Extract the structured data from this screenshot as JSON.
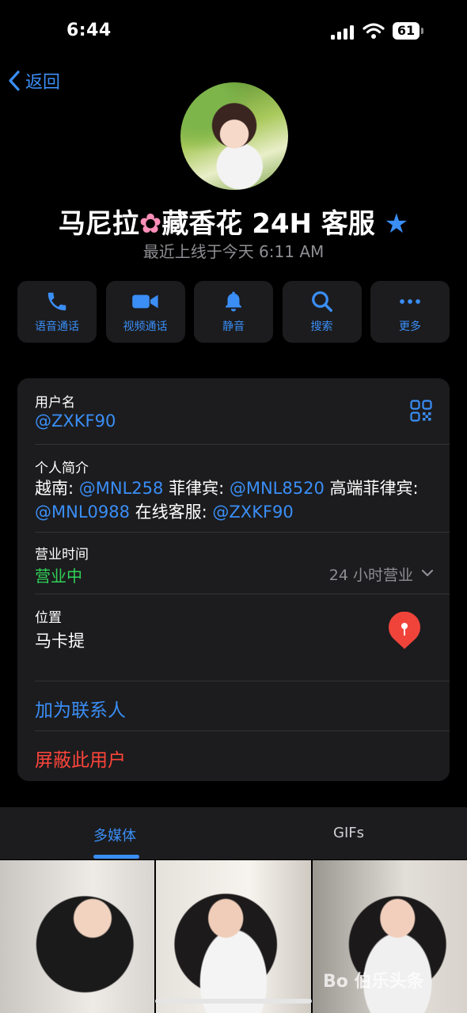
{
  "status_bar": {
    "time": "6:44",
    "battery": "61"
  },
  "nav": {
    "back_label": "返回"
  },
  "profile": {
    "name_a": "马尼拉",
    "name_b": "藏香花 24H 客服",
    "last_seen": "最近上线于今天 6:11 AM"
  },
  "actions": [
    {
      "label": "语音通话",
      "icon": "phone-icon"
    },
    {
      "label": "视频通话",
      "icon": "video-icon"
    },
    {
      "label": "静音",
      "icon": "bell-icon"
    },
    {
      "label": "搜索",
      "icon": "search-icon"
    },
    {
      "label": "更多",
      "icon": "more-icon"
    }
  ],
  "info": {
    "username_label": "用户名",
    "username_value": "@ZXKF90",
    "bio_label": "个人简介",
    "bio": {
      "p1": "越南: ",
      "m1": "@MNL258",
      "p2": " 菲律宾: ",
      "m2": "@MNL8520",
      "p3": " 高端菲律宾: ",
      "m3": "@MNL0988",
      "p4": " 在线客服: ",
      "m4": "@ZXKF90"
    },
    "hours_label": "营业时间",
    "hours_status": "营业中",
    "hours_detail": "24 小时营业",
    "location_label": "位置",
    "location_value": "马卡提",
    "add_contact": "加为联系人",
    "block_user": "屏蔽此用户"
  },
  "tabs": [
    "多媒体",
    "GIFs"
  ],
  "watermark": "Bo 伯乐头条",
  "colors": {
    "accent": "#3a8ef6",
    "danger": "#ff453a",
    "open": "#30d158",
    "pin": "#f0443a"
  }
}
